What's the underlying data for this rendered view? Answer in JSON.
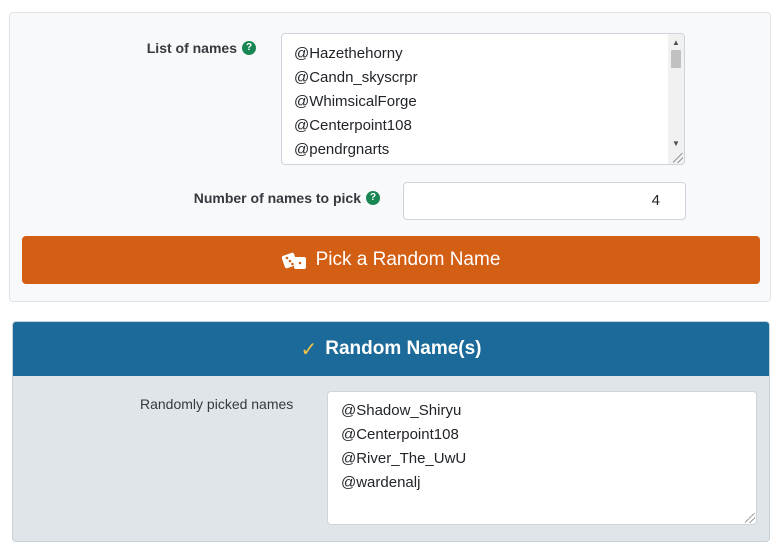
{
  "form": {
    "names_label": "List of names",
    "names": [
      "@Hazethehorny",
      "@Candn_skyscrpr",
      "@WhimsicalForge",
      "@Centerpoint108",
      "@pendrgnarts"
    ],
    "count_label": "Number of names to pick",
    "count_value": "4",
    "pick_button_label": "Pick a Random Name",
    "help_icon": "question-circle-icon",
    "button_icon": "dice-icon",
    "accent_color": "#d35f14"
  },
  "result": {
    "title": "Random Name(s)",
    "title_icon": "check-icon",
    "label": "Randomly picked names",
    "names": [
      "@Shadow_Shiryu",
      "@Centerpoint108",
      "@River_The_UwU",
      "@wardenalj"
    ],
    "header_color": "#1b6a99"
  }
}
